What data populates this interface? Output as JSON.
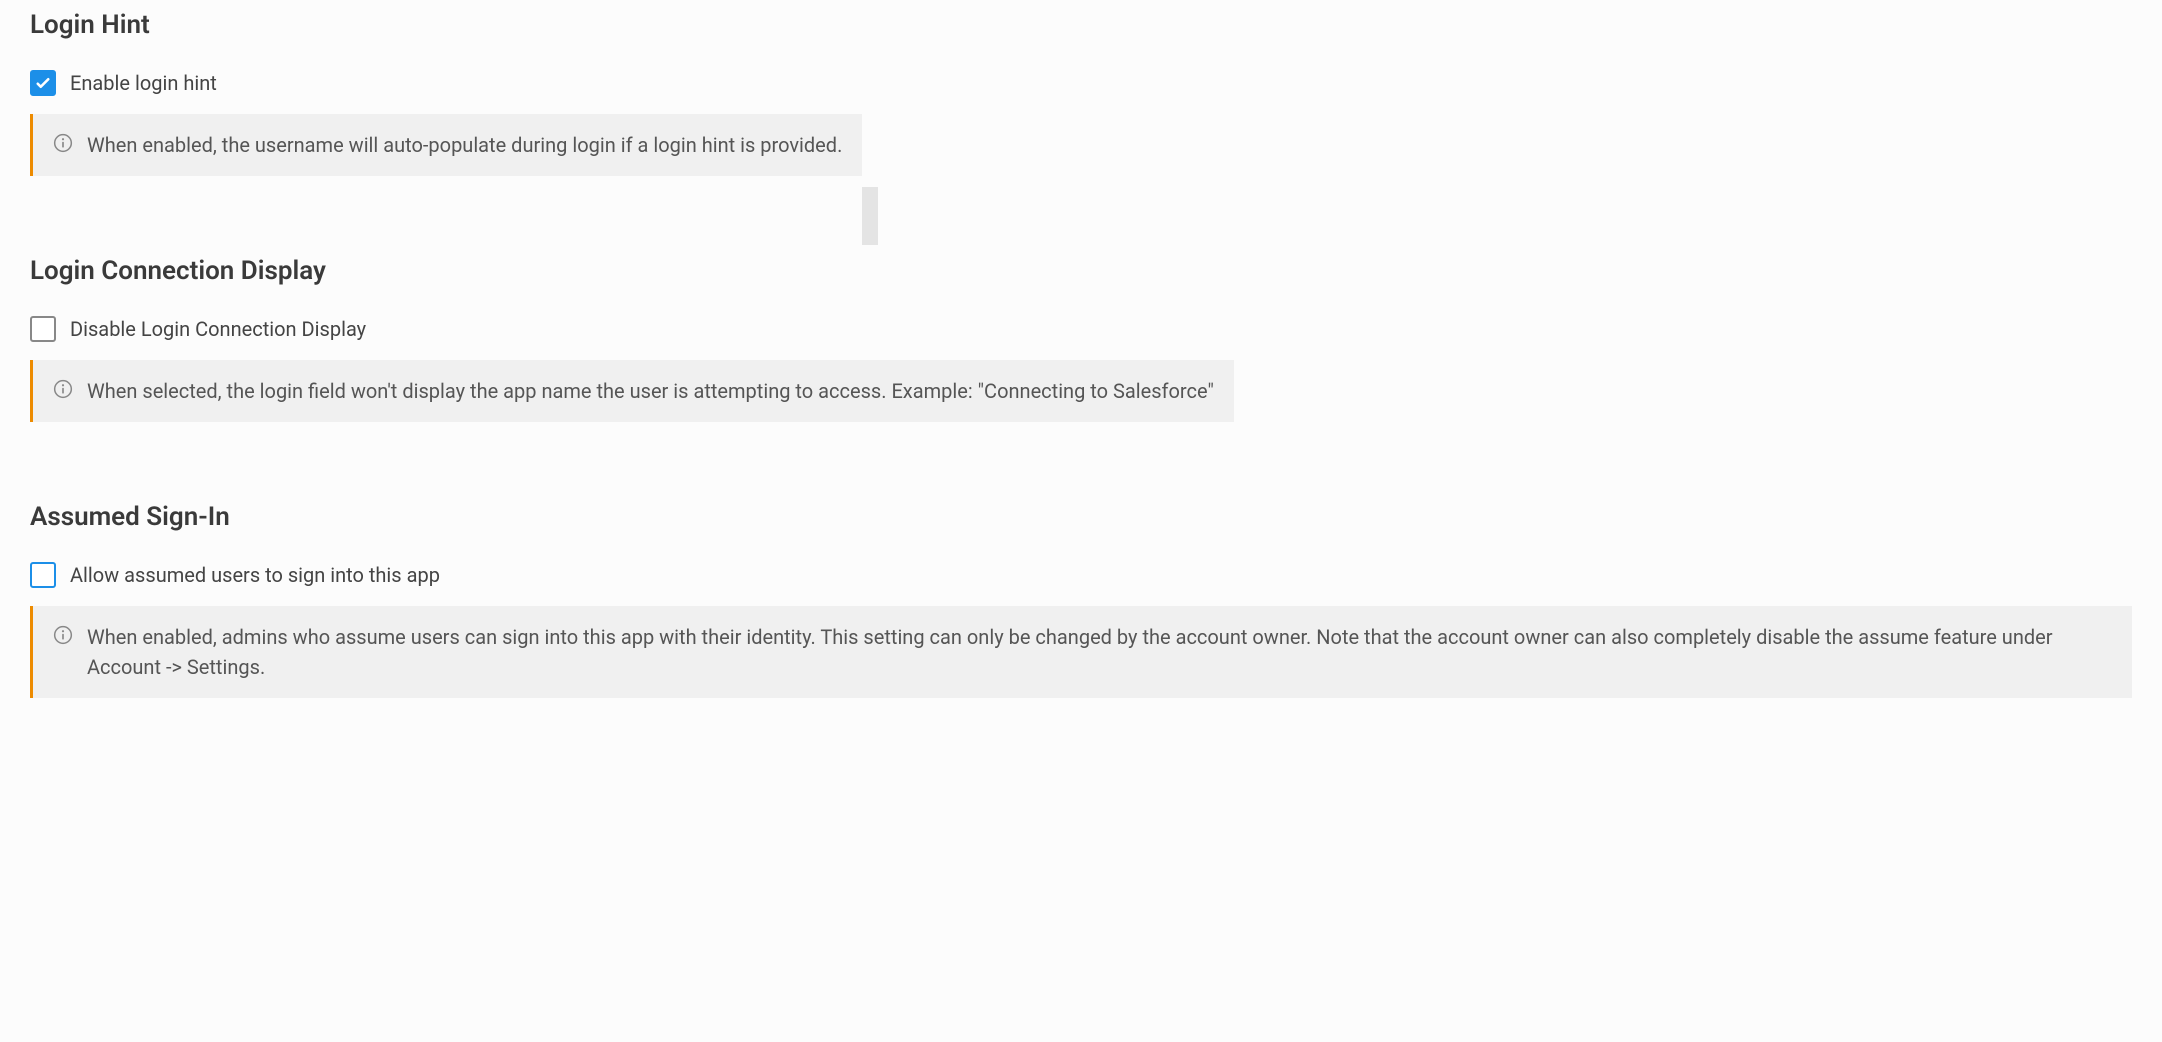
{
  "sections": {
    "login_hint": {
      "title": "Login Hint",
      "checkbox_label": "Enable login hint",
      "checked": true,
      "info": "When enabled, the username will auto-populate during login if a login hint is provided."
    },
    "login_connection_display": {
      "title": "Login Connection Display",
      "checkbox_label": "Disable Login Connection Display",
      "checked": false,
      "info": "When selected, the login field won't display the app name the user is attempting to access. Example: \"Connecting to Salesforce\""
    },
    "assumed_signin": {
      "title": "Assumed Sign-In",
      "checkbox_label": "Allow assumed users to sign into this app",
      "checked": false,
      "info": "When enabled, admins who assume users can sign into this app with their identity. This setting can only be changed by the account owner. Note that the account owner can also completely disable the assume feature under Account -> Settings."
    }
  }
}
